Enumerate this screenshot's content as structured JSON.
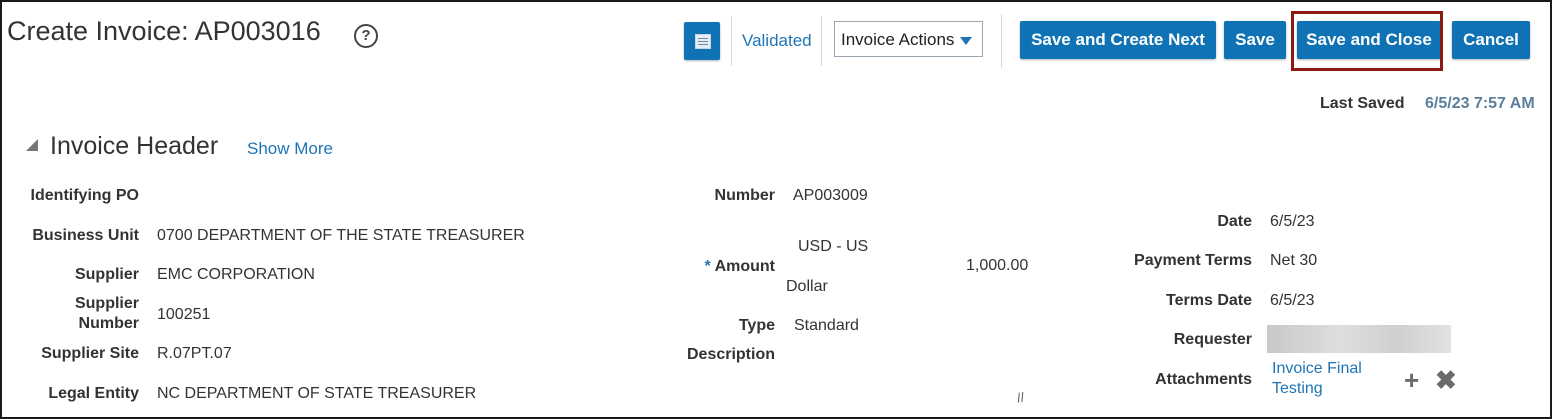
{
  "header": {
    "title": "Create Invoice: AP003016",
    "help_icon": "?",
    "status_link": "Validated",
    "invoice_actions": "Invoice Actions",
    "buttons": {
      "save_create_next": "Save and Create Next",
      "save": "Save",
      "save_close": "Save and Close",
      "cancel": "Cancel"
    },
    "last_saved_label": "Last Saved",
    "last_saved_value": "6/5/23 7:57 AM"
  },
  "section": {
    "title": "Invoice Header",
    "show_more": "Show More"
  },
  "left_fields": {
    "identifying_po_label": "Identifying PO",
    "business_unit_label": "Business Unit",
    "business_unit_value": "0700 DEPARTMENT OF THE STATE TREASURER",
    "supplier_label": "Supplier",
    "supplier_value": "EMC CORPORATION",
    "supplier_number_label_1": "Supplier",
    "supplier_number_label_2": "Number",
    "supplier_number_value": "100251",
    "supplier_site_label": "Supplier Site",
    "supplier_site_value": "R.07PT.07",
    "legal_entity_label": "Legal Entity",
    "legal_entity_value": "NC DEPARTMENT OF STATE TREASURER"
  },
  "middle_fields": {
    "number_label": "Number",
    "number_value": "AP003009",
    "amount_required": "*",
    "amount_label": "Amount",
    "currency_line1": "USD - US",
    "currency_line2": "Dollar",
    "amount_value": "1,000.00",
    "type_label": "Type",
    "type_value": "Standard",
    "description_label": "Description"
  },
  "right_fields": {
    "date_label": "Date",
    "date_value": "6/5/23",
    "payment_terms_label": "Payment Terms",
    "payment_terms_value": "Net 30",
    "terms_date_label": "Terms Date",
    "terms_date_value": "6/5/23",
    "requester_label": "Requester",
    "attachments_label": "Attachments",
    "attachment_link_1": "Invoice Final",
    "attachment_link_2": "Testing"
  },
  "colors": {
    "button_blue": "#0f72b4",
    "link_blue": "#1f74b5",
    "highlight": "#8b1a10"
  }
}
